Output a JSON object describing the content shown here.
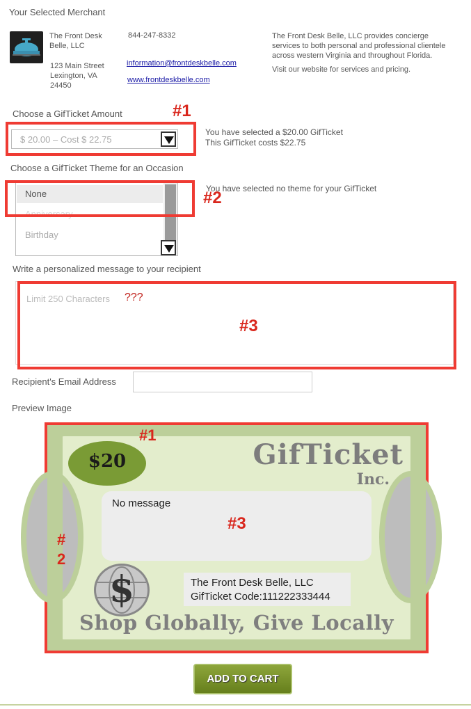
{
  "merchant": {
    "section_title": "Your Selected Merchant",
    "name_line1": "The Front Desk",
    "name_line2": "Belle, LLC",
    "address_line1": "123 Main Street",
    "address_line2": "Lexington, VA",
    "address_line3": "24450",
    "phone": "844-247-8332",
    "email": "information@frontdeskbelle.com",
    "website": "www.frontdeskbelle.com",
    "desc_line1": "The Front Desk Belle, LLC provides concierge",
    "desc_line2": "services to both personal and professional clientele",
    "desc_line3": "across western Virginia and throughout Florida.",
    "desc_line4": "Visit our website for services and pricing."
  },
  "amount": {
    "label": "Choose a GifTicket Amount",
    "selected": "$ 20.00 – Cost $ 22.75",
    "summary_line1": "You have selected a $20.00  GifTicket",
    "summary_line2": "This GifTicket costs $22.75"
  },
  "theme": {
    "label": "Choose a GifTicket Theme for an Occasion",
    "options": [
      "None",
      "Anniversary",
      "Birthday"
    ],
    "summary": "You have selected no theme for your GifTicket"
  },
  "message": {
    "label": "Write a personalized message to your recipient",
    "placeholder": "Limit 250 Characters",
    "question": "???"
  },
  "recipient": {
    "label": "Recipient's Email  Address",
    "value": ""
  },
  "preview": {
    "label": "Preview Image",
    "amount": "$20",
    "brand": "GifTicket",
    "brand_suffix": "Inc.",
    "message": "No message",
    "merchant": "The Front Desk Belle, LLC",
    "code": "GifTicket Code:111222333444",
    "slogan": "Shop Globally, Give Locally",
    "currency_symbol": "$"
  },
  "annotations": {
    "n1": "#1",
    "n2": "#2",
    "n3": "#3",
    "n2_hash": "#",
    "n2_digit": "2"
  },
  "cart": {
    "label": "ADD TO CART"
  },
  "colors": {
    "annotation_red": "#ef3b33",
    "ticket_green": "#bccf9a",
    "oval_green": "#7a9b35",
    "button_green": "#7a931f"
  }
}
